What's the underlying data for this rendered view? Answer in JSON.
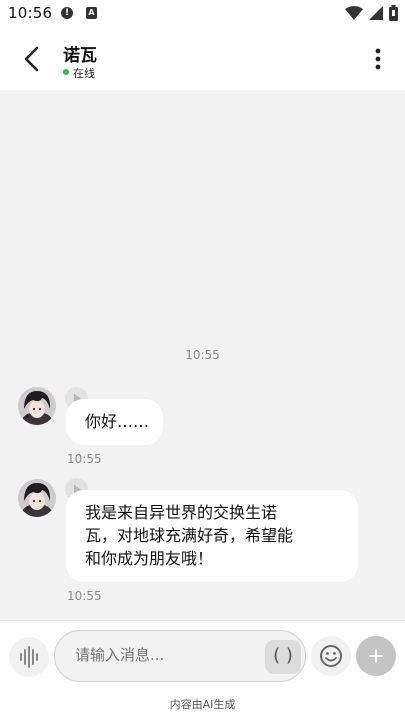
{
  "status_bar": {
    "time": "10:56",
    "icons": [
      "alert-icon",
      "a-icon",
      "wifi-icon",
      "signal-icon",
      "battery-icon"
    ]
  },
  "header": {
    "contact_name": "诺瓦",
    "status": "在线",
    "status_color": "#3cba54"
  },
  "chat": {
    "timestamp": "10:55",
    "messages": [
      {
        "text": "你好……",
        "time": "10:55"
      },
      {
        "text_lines": [
          "我是来自异世界的交换生诺",
          "瓦，对地球充满好奇，希望能",
          "和你成为朋友哦！"
        ],
        "time": "10:55"
      }
    ]
  },
  "input_bar": {
    "placeholder": "请输入消息...",
    "paren_label": "( )",
    "disclaimer": "内容由AI生成"
  }
}
